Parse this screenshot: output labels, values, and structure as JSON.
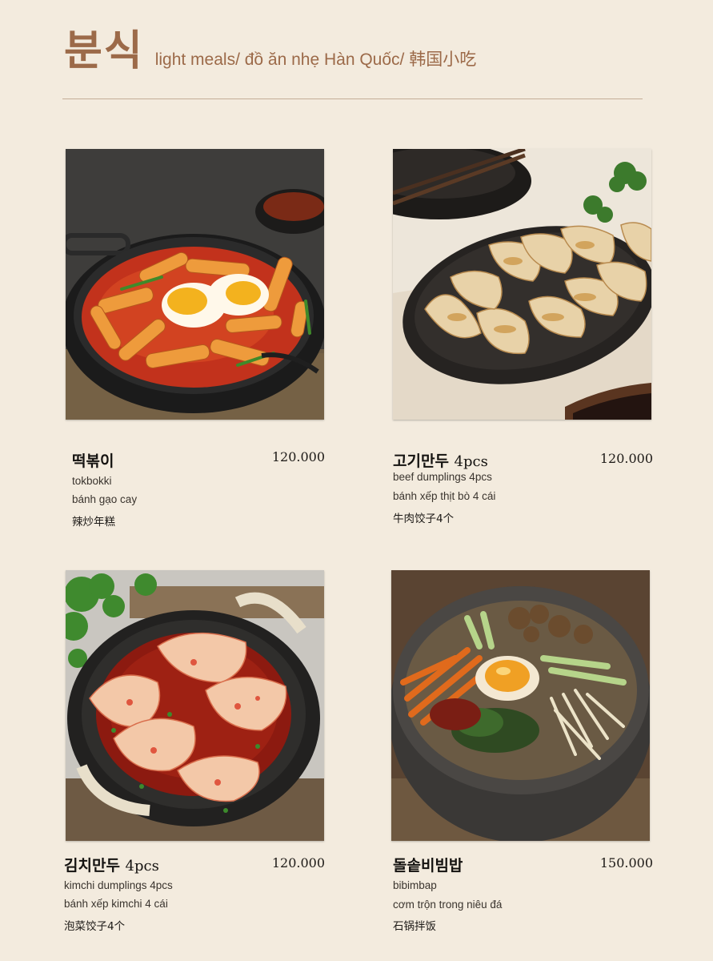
{
  "header": {
    "title": "분식",
    "subtitle": "light meals/ đồ ăn nhẹ Hàn Quốc/ 韩国小吃"
  },
  "items": [
    {
      "name": "떡볶이",
      "pcs": "",
      "price": "120.000",
      "english": "tokbokki",
      "vietnamese": "bánh gạo cay",
      "chinese": "辣炒年糕",
      "image": "tteokbokki-photo"
    },
    {
      "name": "고기만두",
      "pcs": "4pcs",
      "price": "120.000",
      "english": "beef dumplings 4pcs",
      "vietnamese": "bánh xếp thịt bò 4 cái",
      "chinese": "牛肉饺子4个",
      "image": "beef-dumplings-photo"
    },
    {
      "name": "김치만두",
      "pcs": "4pcs",
      "price": "120.000",
      "english": "kimchi dumplings 4pcs",
      "vietnamese": "bánh xếp kimchi 4 cái",
      "chinese": "泡菜饺子4个",
      "image": "kimchi-dumplings-photo"
    },
    {
      "name": "돌솥비빔밥",
      "pcs": "",
      "price": "150.000",
      "english": "bibimbap",
      "vietnamese": "cơm trộn trong niêu đá",
      "chinese": "石锅拌饭",
      "image": "bibimbap-photo"
    }
  ],
  "colors": {
    "background": "#f3ebde",
    "accent": "#9c6a49"
  }
}
